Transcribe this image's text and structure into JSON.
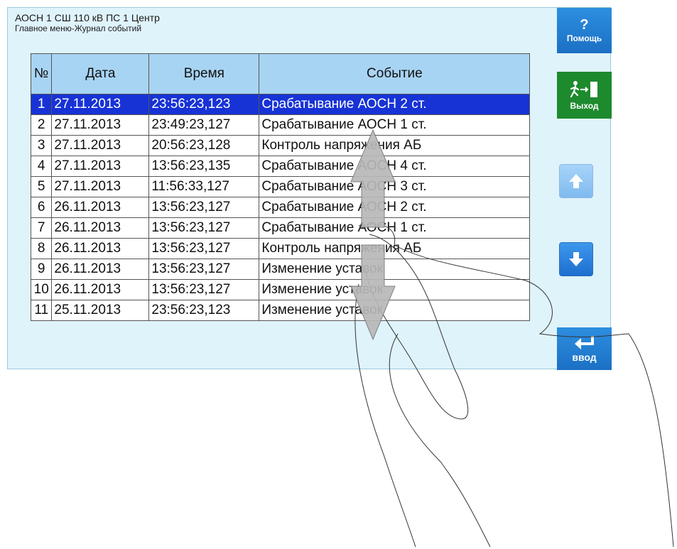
{
  "header": {
    "title": "АОСН 1 СШ 110 кВ ПС 1 Центр",
    "subtitle": "Главное меню-Журнал событий"
  },
  "table": {
    "columns": [
      "№",
      "Дата",
      "Время",
      "Событие"
    ],
    "rows": [
      {
        "n": "1",
        "date": "27.11.2013",
        "time": "23:56:23,123",
        "event": "Срабатывание АОСН 2 ст."
      },
      {
        "n": "2",
        "date": "27.11.2013",
        "time": "23:49:23,127",
        "event": "Срабатывание АОСН 1 ст."
      },
      {
        "n": "3",
        "date": "27.11.2013",
        "time": "20:56:23,128",
        "event": "Контроль напряжения АБ"
      },
      {
        "n": "4",
        "date": "27.11.2013",
        "time": "13:56:23,135",
        "event": "Срабатывание АОСН 4 ст."
      },
      {
        "n": "5",
        "date": "27.11.2013",
        "time": "11:56:33,127",
        "event": "Срабатывание АОСН 3 ст."
      },
      {
        "n": "6",
        "date": "26.11.2013",
        "time": "13:56:23,127",
        "event": "Срабатывание АОСН 2 ст."
      },
      {
        "n": "7",
        "date": "26.11.2013",
        "time": "13:56:23,127",
        "event": "Срабатывание АОСН 1 ст."
      },
      {
        "n": "8",
        "date": "26.11.2013",
        "time": "13:56:23,127",
        "event": "Контроль напряжения АБ"
      },
      {
        "n": "9",
        "date": "26.11.2013",
        "time": "13:56:23,127",
        "event": "Изменение уставок"
      },
      {
        "n": "10",
        "date": "26.11.2013",
        "time": "13:56:23,127",
        "event": "Изменение уставок"
      },
      {
        "n": "11",
        "date": "25.11.2013",
        "time": "23:56:23,123",
        "event": "Изменение уставок"
      }
    ],
    "selected_row": "1"
  },
  "buttons": {
    "help_glyph": "?",
    "help_label": "Помощь",
    "exit_label": "Выход",
    "enter_label": "ввод"
  },
  "icons": {
    "help": "question-mark-icon",
    "exit": "running-man-exit-icon",
    "up": "arrow-up-icon",
    "down": "arrow-down-icon",
    "enter": "return-arrow-icon",
    "gesture": "swipe-hand-icon"
  },
  "colors": {
    "screen_bg": "#dff3fb",
    "header_bg": "#a8d4f4",
    "selected_row_bg": "#1733d6",
    "button_blue": "#1b70c4",
    "button_green": "#1e8a2e"
  }
}
